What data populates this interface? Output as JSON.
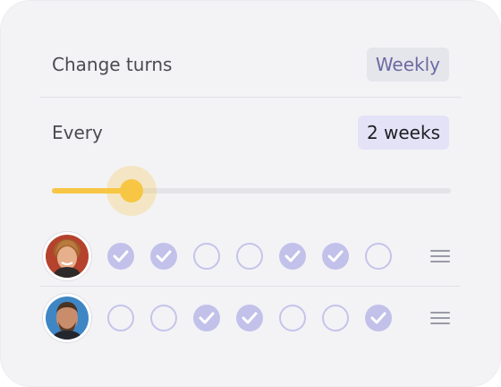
{
  "settings": {
    "change_turns_label": "Change turns",
    "change_turns_value": "Weekly",
    "every_label": "Every",
    "every_value": "2 weeks",
    "slider_fraction": 0.2
  },
  "people": [
    {
      "avatar": "avatar-icon",
      "days": [
        true,
        true,
        false,
        false,
        true,
        true,
        false
      ]
    },
    {
      "avatar": "avatar-icon",
      "days": [
        false,
        false,
        true,
        true,
        false,
        false,
        true
      ]
    }
  ],
  "colors": {
    "accent": "#f7c644",
    "check_on": "#c2c1ea",
    "check_off": "#c5c4ea",
    "weekly_badge_text": "#6a6aa2"
  }
}
